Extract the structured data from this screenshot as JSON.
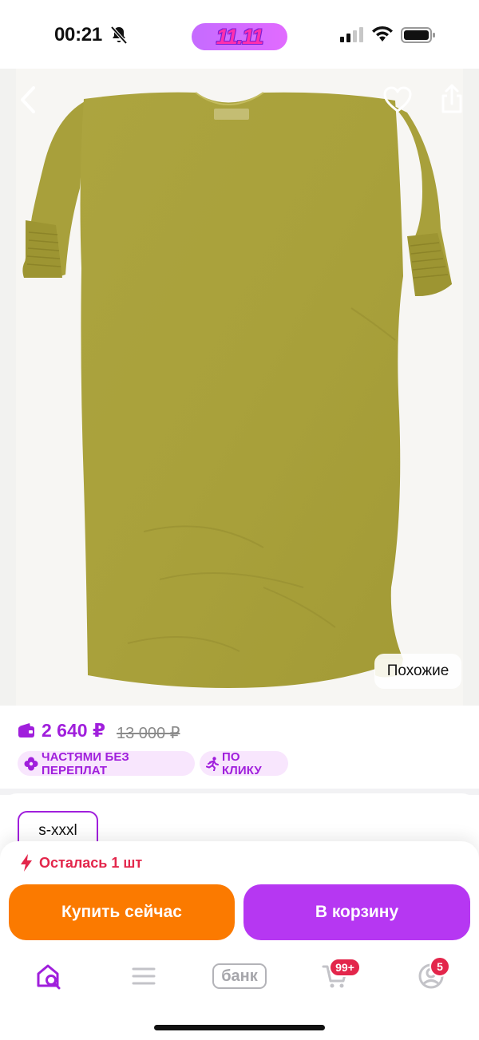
{
  "status_bar": {
    "time": "00:21",
    "promo": "11.11"
  },
  "product": {
    "image_subject": "olive green dress",
    "similar_label": "Похожие"
  },
  "pricing": {
    "price": "2 640 ₽",
    "old_price": "13 000 ₽",
    "badges": [
      {
        "label": "ЧАСТЯМИ БЕЗ ПЕРЕПЛАТ",
        "icon": "installments-icon"
      },
      {
        "label": "ПО КЛИКУ",
        "icon": "runner-icon"
      }
    ]
  },
  "size": {
    "selected": "s-xxxl"
  },
  "purchase": {
    "stock_text": "Осталась 1 шт",
    "buy_now_label": "Купить сейчас",
    "add_to_cart_label": "В корзину"
  },
  "nav": {
    "bank_label": "банк",
    "cart_badge": "99+",
    "profile_badge": "5"
  },
  "colors": {
    "accent_purple": "#a01fdc",
    "cart_button": "#b637f2",
    "buy_button": "#fb7a00",
    "alert_red": "#e3264b",
    "dress": "#a9a13d"
  }
}
